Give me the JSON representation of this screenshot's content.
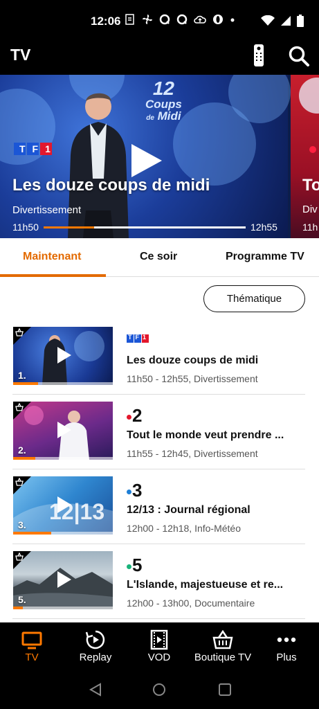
{
  "status_bar": {
    "time": "12:06",
    "colors": {
      "bg": "#000000",
      "fg": "#ffffff"
    }
  },
  "header": {
    "title": "TV",
    "icons": [
      "remote-control-icon",
      "search-icon"
    ]
  },
  "hero": {
    "channel_logo": "TF1",
    "show_logo": [
      "12",
      "Coups",
      "de",
      "Midi"
    ],
    "title": "Les douze coups de midi",
    "genre": "Divertissement",
    "start": "11h50",
    "end": "12h55",
    "progress": 0.25,
    "next_card_title_partial": "To",
    "next_card_genre_partial": "Div",
    "next_card_time_partial": "11h"
  },
  "tabs": [
    {
      "label": "Maintenant",
      "active": true
    },
    {
      "label": "Ce soir",
      "active": false
    },
    {
      "label": "Programme TV",
      "active": false
    }
  ],
  "filter_button": "Thématique",
  "programs": [
    {
      "number": "1.",
      "channel": "TF1",
      "title": "Les douze coups de midi",
      "meta": "11h50 - 12h55, Divertissement",
      "progress": 0.25
    },
    {
      "number": "2.",
      "channel": "2",
      "title": "Tout le monde veut prendre ...",
      "meta": "11h55 - 12h45, Divertissement",
      "progress": 0.22
    },
    {
      "number": "3.",
      "channel": "3",
      "title": "12/13 : Journal régional",
      "meta": "12h00 - 12h18, Info-Météo",
      "progress": 0.38
    },
    {
      "number": "5.",
      "channel": "5",
      "title": "L'Islande, majestueuse et re...",
      "meta": "12h00 - 13h00, Documentaire",
      "progress": 0.1
    }
  ],
  "bottom_nav": [
    {
      "label": "TV",
      "icon": "tv-icon",
      "active": true
    },
    {
      "label": "Replay",
      "icon": "replay-icon",
      "active": false
    },
    {
      "label": "VOD",
      "icon": "film-icon",
      "active": false
    },
    {
      "label": "Boutique TV",
      "icon": "basket-icon",
      "active": false
    },
    {
      "label": "Plus",
      "icon": "more-dots-icon",
      "active": false
    }
  ],
  "colors": {
    "accent": "#ff7900",
    "tab_active": "#e36a00",
    "header_bg": "#000000"
  }
}
